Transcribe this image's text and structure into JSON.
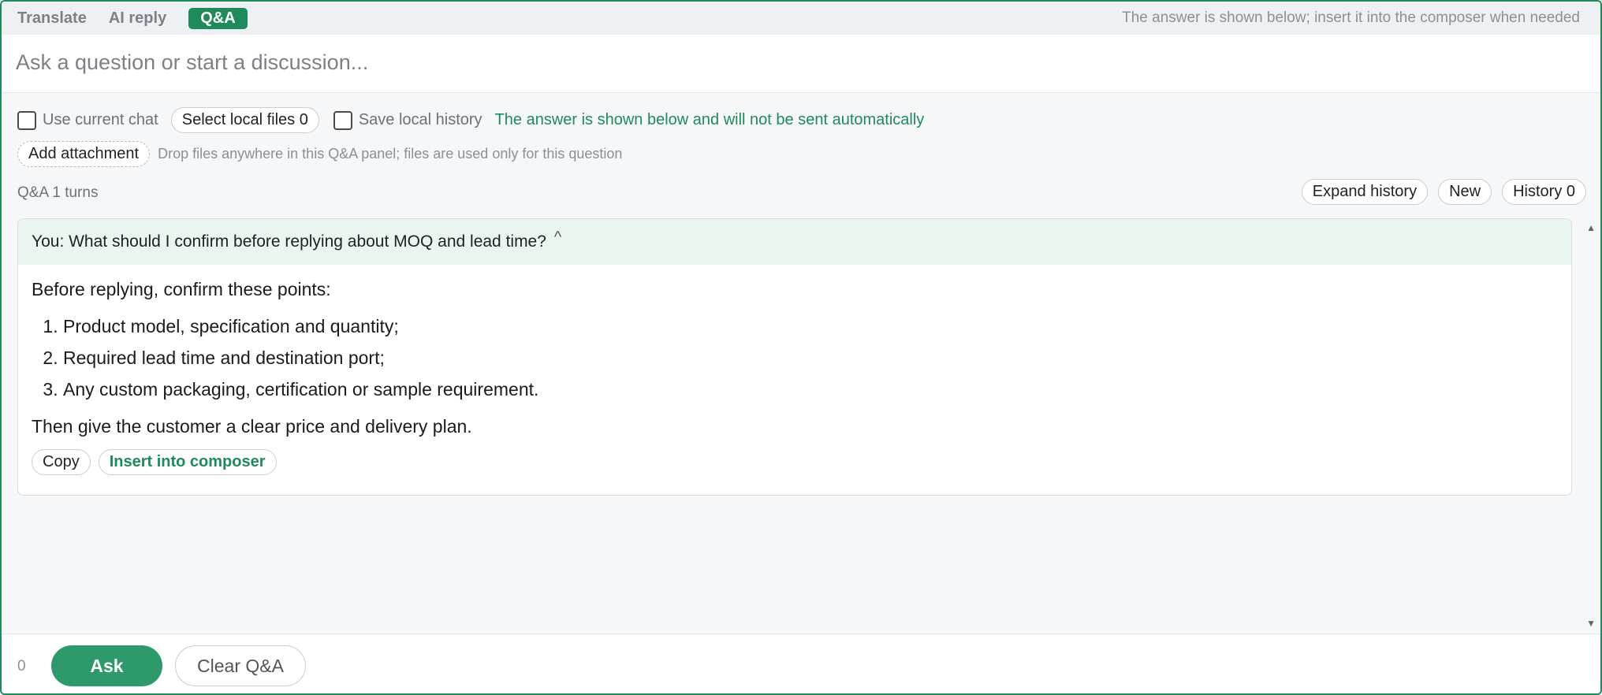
{
  "tabs": [
    {
      "label": "Translate",
      "active": false
    },
    {
      "label": "AI reply",
      "active": false
    },
    {
      "label": "Q&A",
      "active": true
    }
  ],
  "tab_hint": "The answer is shown below; insert it into the composer when needed",
  "question": {
    "placeholder": "Ask a question or start a discussion...",
    "value": ""
  },
  "options": {
    "use_current_chat": "Use current chat",
    "select_local_files": "Select local files 0",
    "save_local_history": "Save local history",
    "auto_note": "The answer is shown below and will not be sent automatically",
    "add_attachment": "Add attachment",
    "drop_hint": "Drop files anywhere in this Q&A panel; files are used only for this question"
  },
  "history": {
    "turns_label": "Q&A 1 turns",
    "expand": "Expand history",
    "new": "New",
    "history_count": "History 0"
  },
  "conversation": {
    "question_text": "You: What should I confirm before replying about MOQ and lead time?",
    "caret": "^",
    "answer_intro": "Before replying, confirm these points:",
    "answer_items": [
      "Product model, specification and quantity;",
      "Required lead time and destination port;",
      "Any custom packaging, certification or sample requirement."
    ],
    "answer_outro": "Then give the customer a clear price and delivery plan.",
    "copy_label": "Copy",
    "insert_label": "Insert into composer"
  },
  "footer": {
    "char_count": "0",
    "ask_label": "Ask",
    "clear_label": "Clear Q&A"
  },
  "colors": {
    "accent": "#1f8a5b",
    "question_bg": "#eaf5ef",
    "panel_bg": "#f5f7f8"
  }
}
